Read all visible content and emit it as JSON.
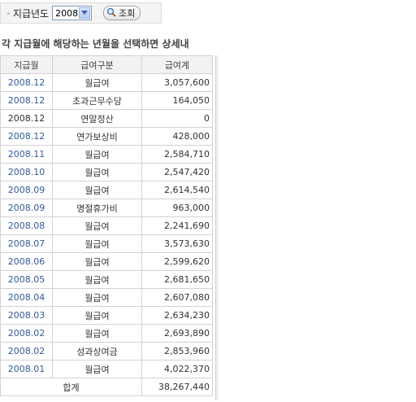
{
  "filter": {
    "chevron": "»",
    "label": "지급년도",
    "year": "2008",
    "search_label": "조회",
    "search_icon": "magnifier-icon"
  },
  "notice": "각 지급월에 해당하는 년월을 선택하면 상세내",
  "table": {
    "headers": [
      "지급월",
      "급여구분",
      "급여계"
    ],
    "rows": [
      {
        "month": "2008.12",
        "type": "월급여",
        "amount": "3,057,600",
        "link": true
      },
      {
        "month": "2008.12",
        "type": "초과근무수당",
        "amount": "164,050",
        "link": true
      },
      {
        "month": "2008.12",
        "type": "연말정산",
        "amount": "0",
        "link": false
      },
      {
        "month": "2008.12",
        "type": "연가보상비",
        "amount": "428,000",
        "link": true
      },
      {
        "month": "2008.11",
        "type": "월급여",
        "amount": "2,584,710",
        "link": true
      },
      {
        "month": "2008.10",
        "type": "월급여",
        "amount": "2,547,420",
        "link": true
      },
      {
        "month": "2008.09",
        "type": "월급여",
        "amount": "2,614,540",
        "link": true
      },
      {
        "month": "2008.09",
        "type": "명절휴가비",
        "amount": "963,000",
        "link": true
      },
      {
        "month": "2008.08",
        "type": "월급여",
        "amount": "2,241,690",
        "link": true
      },
      {
        "month": "2008.07",
        "type": "월급여",
        "amount": "3,573,630",
        "link": true
      },
      {
        "month": "2008.06",
        "type": "월급여",
        "amount": "2,599,620",
        "link": true
      },
      {
        "month": "2008.05",
        "type": "월급여",
        "amount": "2,681,650",
        "link": true
      },
      {
        "month": "2008.04",
        "type": "월급여",
        "amount": "2,607,080",
        "link": true
      },
      {
        "month": "2008.03",
        "type": "월급여",
        "amount": "2,634,230",
        "link": true
      },
      {
        "month": "2008.02",
        "type": "월급여",
        "amount": "2,693,890",
        "link": true
      },
      {
        "month": "2008.02",
        "type": "성과상여금",
        "amount": "2,853,960",
        "link": true
      },
      {
        "month": "2008.01",
        "type": "월급여",
        "amount": "4,022,370",
        "link": true
      }
    ],
    "total_label": "합계",
    "total_amount": "38,267,440"
  },
  "colors": {
    "link": "#335a9a",
    "header_bg": "#f2f2f2",
    "border": "#d2d2d2"
  }
}
